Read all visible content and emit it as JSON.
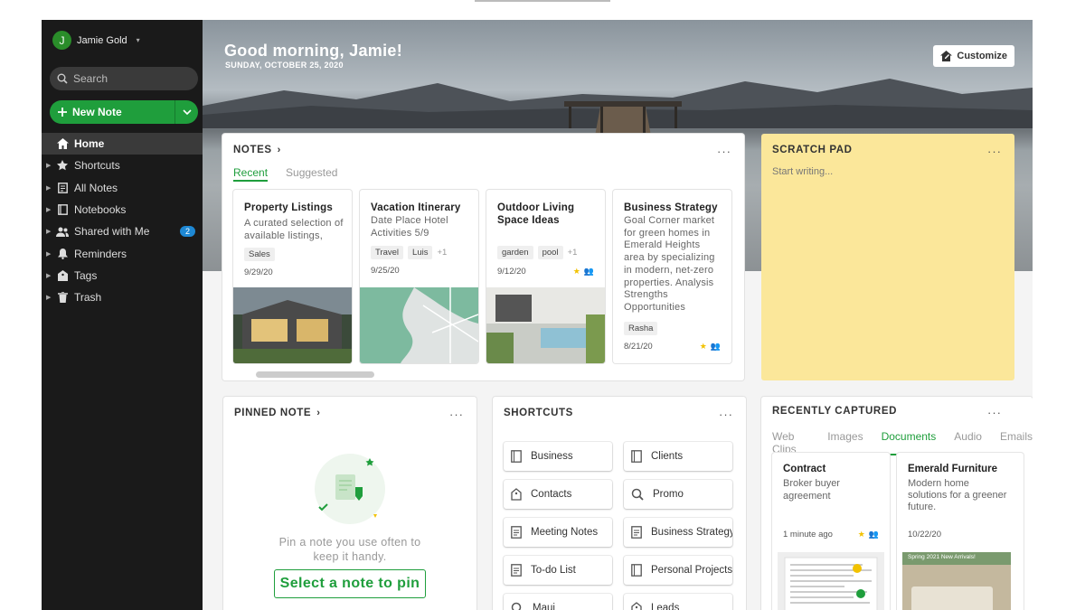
{
  "user": {
    "name": "Jamie Gold",
    "initial": "J"
  },
  "search": {
    "placeholder": "Search"
  },
  "new_note": {
    "label": "New Note"
  },
  "nav": [
    {
      "label": "Home",
      "icon": "home-icon",
      "active": true
    },
    {
      "label": "Shortcuts",
      "icon": "star-icon"
    },
    {
      "label": "All Notes",
      "icon": "note-icon"
    },
    {
      "label": "Notebooks",
      "icon": "notebook-icon"
    },
    {
      "label": "Shared with Me",
      "icon": "people-icon",
      "badge": "2"
    },
    {
      "label": "Reminders",
      "icon": "bell-icon"
    },
    {
      "label": "Tags",
      "icon": "tag-icon"
    },
    {
      "label": "Trash",
      "icon": "trash-icon"
    }
  ],
  "header": {
    "greeting": "Good morning, Jamie!",
    "date": "SUNDAY, OCTOBER 25, 2020",
    "customize": "Customize"
  },
  "notes_widget": {
    "title": "NOTES",
    "tabs": [
      "Recent",
      "Suggested"
    ],
    "items": [
      {
        "title": "Property Listings",
        "body": "A curated selection of available listings,",
        "tags": [
          "Sales"
        ],
        "more": "",
        "date": "9/29/20"
      },
      {
        "title": "Vacation Itinerary",
        "body": "Date Place Hotel Activities 5/9",
        "tags": [
          "Travel",
          "Luis"
        ],
        "more": "+1",
        "date": "9/25/20"
      },
      {
        "title": "Outdoor Living Space Ideas",
        "body": "",
        "tags": [
          "garden",
          "pool"
        ],
        "more": "+1",
        "date": "9/12/20"
      },
      {
        "title": "Business Strategy",
        "body": "Goal Corner market for green homes in Emerald Heights area by specializing in modern, net-zero properties. Analysis Strengths Opportunities",
        "tags": [
          "Rasha"
        ],
        "more": "",
        "date": "8/21/20"
      }
    ]
  },
  "scratch_pad": {
    "title": "SCRATCH PAD",
    "placeholder": "Start writing..."
  },
  "pinned": {
    "title": "PINNED NOTE",
    "text": "Pin a note you use often to keep it handy.",
    "button": "Select a note to pin"
  },
  "shortcuts": {
    "title": "SHORTCUTS",
    "items": [
      {
        "label": "Business",
        "icon": "note-icon"
      },
      {
        "label": "Clients",
        "icon": "note-icon"
      },
      {
        "label": "Contacts",
        "icon": "tag-icon"
      },
      {
        "label": "Promo",
        "icon": "search-icon"
      },
      {
        "label": "Meeting Notes",
        "icon": "doc-icon"
      },
      {
        "label": "Business Strategy",
        "icon": "doc-icon"
      },
      {
        "label": "To-do List",
        "icon": "doc-icon"
      },
      {
        "label": "Personal Projects",
        "icon": "note-icon"
      },
      {
        "label": "Maui",
        "icon": "search-icon"
      },
      {
        "label": "Leads",
        "icon": "tag-icon"
      }
    ]
  },
  "recently_captured": {
    "title": "RECENTLY CAPTURED",
    "tabs": [
      "Web Clips",
      "Images",
      "Documents",
      "Audio",
      "Emails"
    ],
    "active_tab": "Documents",
    "items": [
      {
        "title": "Contract",
        "body": "Broker buyer agreement",
        "date": "1 minute ago"
      },
      {
        "title": "Emerald Furniture",
        "body": "Modern home solutions for a greener future.",
        "date": "10/22/20",
        "image_caption": "Spring 2021 New Arrivals!"
      }
    ]
  },
  "colors": {
    "accent": "#1f9e3c",
    "sidebar": "#1a1a1a",
    "scratch": "#fbe79a",
    "badge": "#1e88d4",
    "star": "#f2c200"
  }
}
